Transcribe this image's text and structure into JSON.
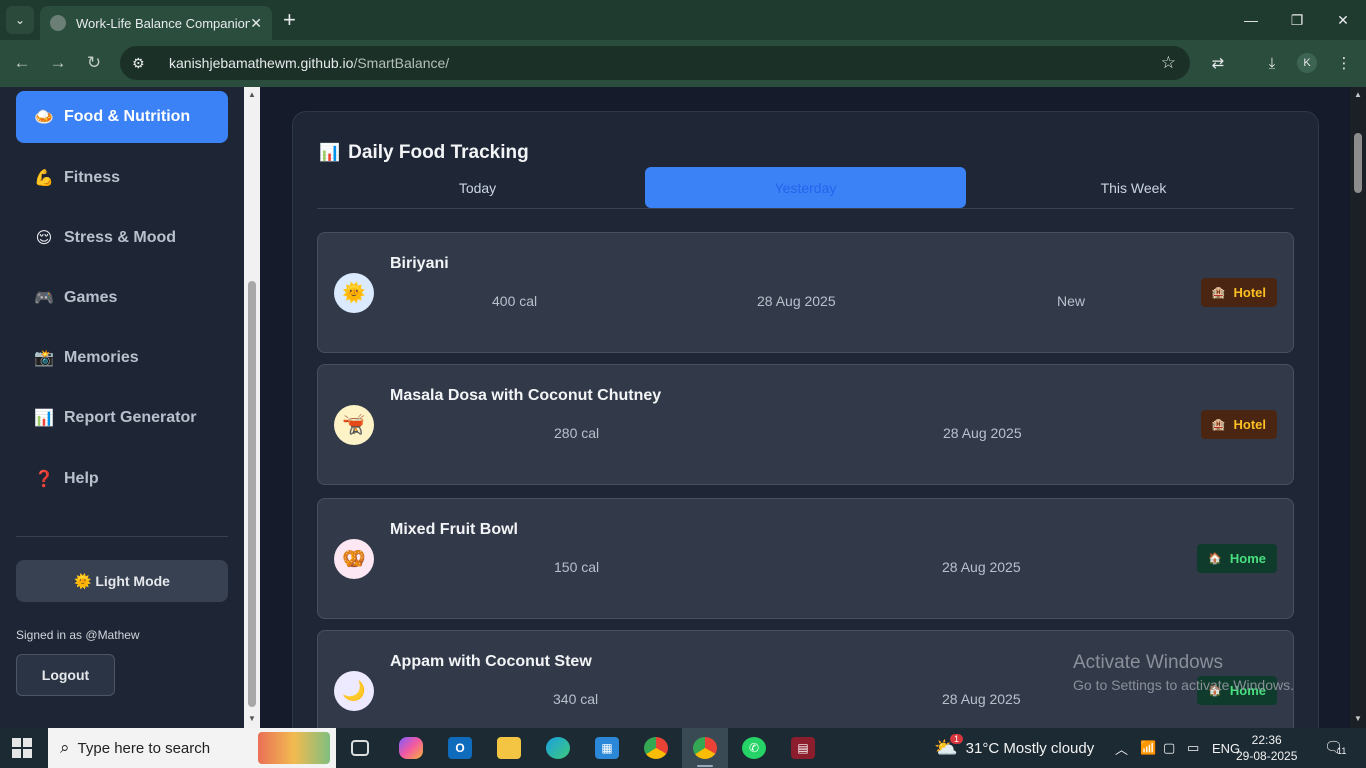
{
  "browser": {
    "tab_title": "Work-Life Balance Companion",
    "url_host": "kanishjebamathewm.github.io",
    "url_path": "/SmartBalance/",
    "profile_initial": "K"
  },
  "sidebar": {
    "items": [
      {
        "icon": "🍛",
        "label": "Food & Nutrition",
        "active": true
      },
      {
        "icon": "💪",
        "label": "Fitness"
      },
      {
        "icon": "😌",
        "label": "Stress & Mood"
      },
      {
        "icon": "🎮",
        "label": "Games"
      },
      {
        "icon": "📸",
        "label": "Memories"
      },
      {
        "icon": "📊",
        "label": "Report Generator"
      },
      {
        "icon": "❓",
        "label": "Help"
      }
    ],
    "mode_button": "🌞 Light Mode",
    "signed_in": "Signed in as @Mathew",
    "logout": "Logout"
  },
  "tracker": {
    "title_icon": "📊",
    "title": "Daily Food Tracking",
    "tabs": [
      "Today",
      "Yesterday",
      "This Week"
    ],
    "active_tab": "Yesterday",
    "entries": [
      {
        "icon": "🌞",
        "icon_bg": "#dbeafe",
        "name": "Biriyani",
        "calories": "400 cal",
        "date": "28 Aug 2025",
        "note": "New",
        "tag_icon": "🏨",
        "tag": "Hotel",
        "tag_type": "hotel"
      },
      {
        "icon": "🫕",
        "icon_bg": "#fef3c7",
        "name": "Masala Dosa with Coconut Chutney",
        "calories": "280 cal",
        "date": "28 Aug 2025",
        "tag_icon": "🏨",
        "tag": "Hotel",
        "tag_type": "hotel"
      },
      {
        "icon": "🥨",
        "icon_bg": "#fce7f3",
        "name": "Mixed Fruit Bowl",
        "calories": "150 cal",
        "date": "28 Aug 2025",
        "tag_icon": "🏠",
        "tag": "Home",
        "tag_type": "home"
      },
      {
        "icon": "🌙",
        "icon_bg": "#ede9fe",
        "name": "Appam with Coconut Stew",
        "calories": "340 cal",
        "date": "28 Aug 2025",
        "tag_icon": "🏠",
        "tag": "Home",
        "tag_type": "home"
      }
    ]
  },
  "watermark": {
    "line1": "Activate Windows",
    "line2": "Go to Settings to activate Windows."
  },
  "taskbar": {
    "search_placeholder": "Type here to search",
    "weather_badge": "1",
    "weather": "31°C  Mostly cloudy",
    "language": "ENG",
    "time": "22:36",
    "date": "29-08-2025",
    "notifications": "11"
  }
}
